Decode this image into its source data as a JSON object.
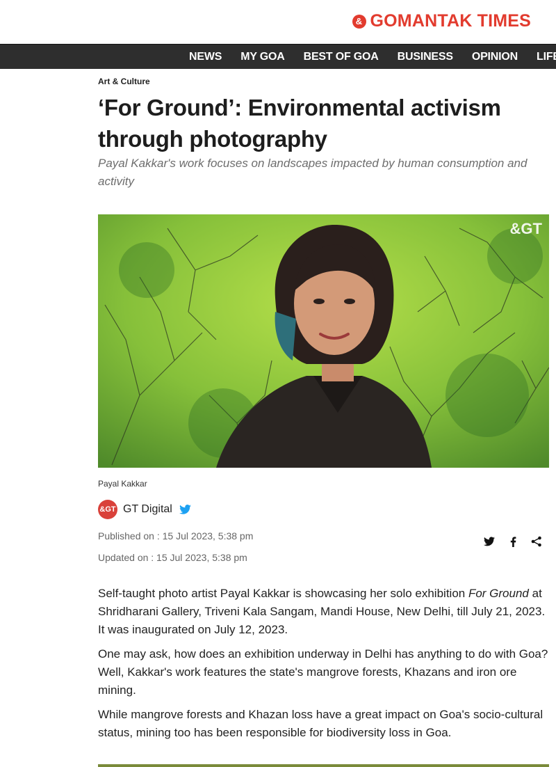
{
  "brand": {
    "name": "GOMANTAK TIMES",
    "mark": "&",
    "color": "#e23b2e"
  },
  "nav": {
    "items": [
      "NEWS",
      "MY GOA",
      "BEST OF GOA",
      "BUSINESS",
      "OPINION",
      "LIFESTYLE"
    ]
  },
  "article": {
    "section": "Art & Culture",
    "title": "‘For Ground’: Environmental activism through photography",
    "subtitle": "Payal Kakkar's work focuses on landscapes impacted by human consumption and activity",
    "hero_watermark": "&GT",
    "caption": "Payal Kakkar",
    "author": {
      "avatar_text": "&GT",
      "name": "GT Digital"
    },
    "published": "Published on : 15 Jul 2023, 5:38 pm",
    "updated": "Updated on : 15 Jul 2023, 5:38 pm",
    "paragraphs": [
      {
        "before": "Self-taught photo artist Payal Kakkar is showcasing her solo exhibition ",
        "emphasis": "For Ground",
        "after": " at Shridharani Gallery, Triveni Kala Sangam, Mandi House, New Delhi, till July 21, 2023. It was inaugurated on July 12, 2023."
      },
      {
        "text": "One may ask, how does an exhibition underway in Delhi has anything to do with Goa? Well, Kakkar's work features the state's mangrove forests, Khazans and iron ore mining."
      },
      {
        "text": "While mangrove forests and Khazan loss have a great impact on Goa's socio-cultural status, mining too has been responsible for biodiversity loss in Goa."
      }
    ]
  },
  "share": {
    "icons": [
      "twitter-icon",
      "facebook-icon",
      "share-icon"
    ]
  },
  "colors": {
    "nav_bg": "#2e2e2e",
    "accent": "#e23b2e",
    "subtitle": "#6d6d6d",
    "twitter": "#1da1f2"
  }
}
